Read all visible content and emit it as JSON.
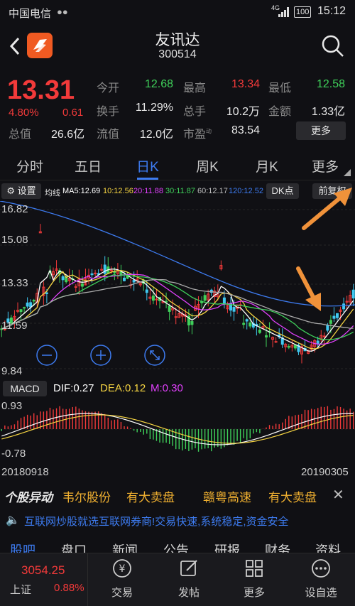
{
  "status": {
    "carrier": "中国电信",
    "network": "4G",
    "battery": "100",
    "time": "15:12"
  },
  "header": {
    "name": "友讯达",
    "code": "300514"
  },
  "quote": {
    "price": "13.31",
    "change_pct": "4.80%",
    "change": "0.61",
    "total_value_label": "总值",
    "total_value": "26.6亿",
    "fields": [
      {
        "label": "今开",
        "value": "12.68",
        "color": "green"
      },
      {
        "label": "最高",
        "value": "13.34",
        "color": "red"
      },
      {
        "label": "最低",
        "value": "12.58",
        "color": "green"
      },
      {
        "label": "换手",
        "value": "11.29%",
        "color": "normal"
      },
      {
        "label": "总手",
        "value": "10.2万",
        "color": "normal"
      },
      {
        "label": "金额",
        "value": "1.33亿",
        "color": "normal"
      },
      {
        "label": "流值",
        "value": "12.0亿",
        "color": "normal"
      },
      {
        "label": "市盈",
        "value": "83.54",
        "color": "normal",
        "sup": "动"
      }
    ],
    "more_label": "更多"
  },
  "tabs": [
    "分时",
    "五日",
    "日K",
    "周K",
    "月K",
    "更多"
  ],
  "active_tab": "日K",
  "ma_bar": {
    "settings_label": "设置",
    "junxian": "均线",
    "ma5": "MA5:12.69",
    "ma10": "10:12.56",
    "ma20": "20:11.88",
    "ma30": "30:11.87",
    "ma60": "60:12.17",
    "ma120": "120:12.52",
    "dk_label": "DK点",
    "fq_label": "前复权"
  },
  "kline": {
    "y_labels": [
      "16.82",
      "15.08",
      "13.33",
      "11.59",
      "9.84"
    ],
    "start_date": "20180918",
    "end_date": "20190305"
  },
  "macd": {
    "label": "MACD",
    "dif": "DIF:0.27",
    "dea": "DEA:0.12",
    "m": "M:0.30",
    "y_top": "0.93",
    "y_bottom": "-0.78"
  },
  "news": {
    "tag": "个股异动",
    "item1_name": "韦尔股份",
    "item1_text": "有大卖盘",
    "item2_name": "赣粤高速",
    "item2_text": "有大卖盘"
  },
  "ad": {
    "text": "互联网炒股就选互联网券商!交易快速,系统稳定,资金安全"
  },
  "subtabs": [
    "股吧",
    "盘口",
    "新闻",
    "公告",
    "研报",
    "财务",
    "资料"
  ],
  "bottom": {
    "index_value": "3054.25",
    "index_name": "上证",
    "index_pct": "0.88%",
    "items": [
      {
        "label": "交易"
      },
      {
        "label": "发帖"
      },
      {
        "label": "更多"
      },
      {
        "label": "设自选"
      }
    ]
  },
  "colors": {
    "up": "#f23a3a",
    "down": "#3fd05a",
    "accent": "#3d7bf0",
    "ma5": "#ffffff",
    "ma10": "#f5d442",
    "ma20": "#e040fb",
    "ma30": "#3fd05a",
    "ma60": "#aaaaaa",
    "ma120": "#3d7bf0",
    "arrow": "#f0923a"
  }
}
